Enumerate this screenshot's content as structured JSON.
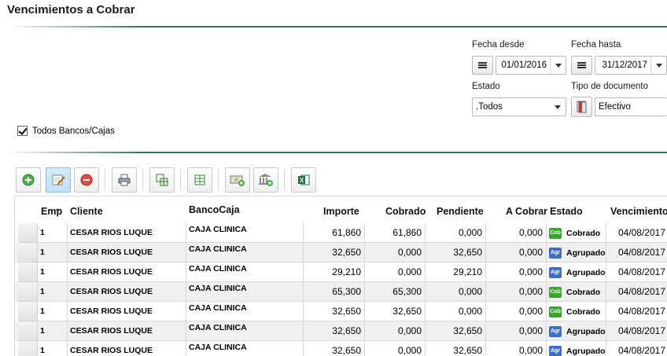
{
  "page": {
    "title": "Vencimientos a Cobrar"
  },
  "filters": {
    "fecha_desde": {
      "label": "Fecha desde",
      "value": "01/01/2016"
    },
    "fecha_hasta": {
      "label": "Fecha hasta",
      "value": "31/12/2017"
    },
    "estado": {
      "label": "Estado",
      "value": ".Todos"
    },
    "tipo_documento": {
      "label": "Tipo de documento",
      "value": "Efectivo"
    },
    "todos_bancos": {
      "label": "Todos Bancos/Cajas",
      "checked": true
    }
  },
  "toolbar": {
    "buttons": [
      "add-icon",
      "edit-icon",
      "delete-icon",
      "print-icon",
      "export-grid-icon",
      "table-icon",
      "cash-add-icon",
      "bank-add-icon",
      "excel-icon"
    ]
  },
  "colors": {
    "accent_rule": "#2f7a55",
    "cobrado_badge": "#3aa52c",
    "agrupado_badge": "#3f6fc4"
  },
  "table": {
    "columns": [
      "Emp",
      "Cliente",
      "BancoCaja",
      "Importe",
      "Cobrado",
      "Pendiente",
      "A Cobrar",
      "Estado",
      "Vencimiento"
    ],
    "rows": [
      {
        "emp": "1",
        "cliente": "CESAR RIOS LUQUE",
        "banco": "CAJA CLINICA",
        "importe": "61,860",
        "cobrado": "61,860",
        "pendiente": "0,000",
        "acobrar": "0,000",
        "badge": "Cob",
        "estado": "Cobrado",
        "vencimiento": "04/08/2017"
      },
      {
        "emp": "1",
        "cliente": "CESAR RIOS LUQUE",
        "banco": "CAJA CLINICA",
        "importe": "32,650",
        "cobrado": "0,000",
        "pendiente": "32,650",
        "acobrar": "0,000",
        "badge": "Agr",
        "estado": "Agrupado",
        "vencimiento": "04/08/2017"
      },
      {
        "emp": "1",
        "cliente": "CESAR RIOS LUQUE",
        "banco": "CAJA CLINICA",
        "importe": "29,210",
        "cobrado": "0,000",
        "pendiente": "29,210",
        "acobrar": "0,000",
        "badge": "Agr",
        "estado": "Agrupado",
        "vencimiento": "04/08/2017"
      },
      {
        "emp": "1",
        "cliente": "CESAR RIOS LUQUE",
        "banco": "CAJA CLINICA",
        "importe": "65,300",
        "cobrado": "65,300",
        "pendiente": "0,000",
        "acobrar": "0,000",
        "badge": "Cob",
        "estado": "Cobrado",
        "vencimiento": "04/08/2017"
      },
      {
        "emp": "1",
        "cliente": "CESAR RIOS LUQUE",
        "banco": "CAJA CLINICA",
        "importe": "32,650",
        "cobrado": "32,650",
        "pendiente": "0,000",
        "acobrar": "0,000",
        "badge": "Cob",
        "estado": "Cobrado",
        "vencimiento": "04/08/2017"
      },
      {
        "emp": "1",
        "cliente": "CESAR RIOS LUQUE",
        "banco": "CAJA CLINICA",
        "importe": "32,650",
        "cobrado": "0,000",
        "pendiente": "32,650",
        "acobrar": "0,000",
        "badge": "Agr",
        "estado": "Agrupado",
        "vencimiento": "04/08/2017"
      },
      {
        "emp": "1",
        "cliente": "CESAR RIOS LUQUE",
        "banco": "CAJA CLINICA",
        "importe": "32,650",
        "cobrado": "0,000",
        "pendiente": "32,650",
        "acobrar": "0,000",
        "badge": "Agr",
        "estado": "Agrupado",
        "vencimiento": "04/08/2017"
      }
    ]
  }
}
